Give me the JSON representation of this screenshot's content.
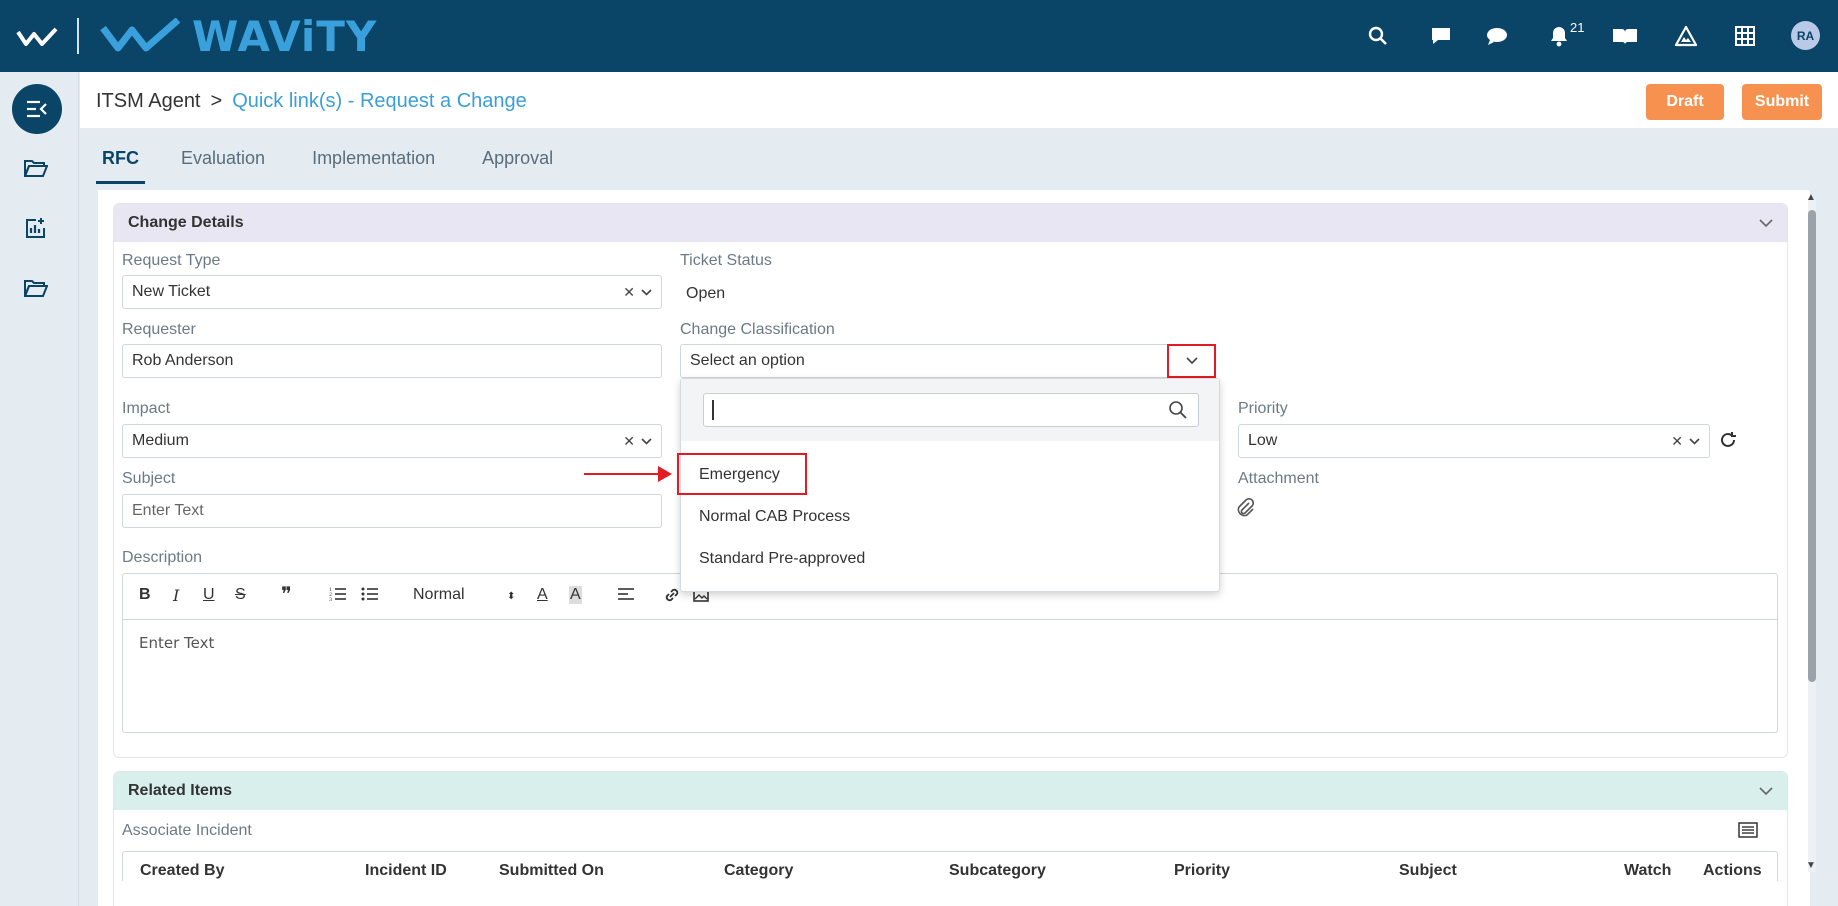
{
  "brand": {
    "name": "WAViTY"
  },
  "topbar": {
    "notification_count": "21",
    "avatar_initials": "RA"
  },
  "breadcrumb": {
    "root": "ITSM Agent",
    "separator": ">",
    "current": "Quick link(s) - Request a Change"
  },
  "actions": {
    "draft_label": "Draft",
    "submit_label": "Submit"
  },
  "tabs": [
    {
      "label": "RFC",
      "active": true
    },
    {
      "label": "Evaluation",
      "active": false
    },
    {
      "label": "Implementation",
      "active": false
    },
    {
      "label": "Approval",
      "active": false
    }
  ],
  "change_details": {
    "title": "Change Details",
    "request_type": {
      "label": "Request Type",
      "value": "New Ticket"
    },
    "ticket_status": {
      "label": "Ticket Status",
      "value": "Open"
    },
    "requester": {
      "label": "Requester",
      "value": "Rob Anderson"
    },
    "change_classification": {
      "label": "Change Classification",
      "placeholder": "Select an option"
    },
    "impact": {
      "label": "Impact",
      "value": "Medium"
    },
    "priority": {
      "label": "Priority",
      "value": "Low"
    },
    "subject": {
      "label": "Subject",
      "placeholder": "Enter Text"
    },
    "attachment": {
      "label": "Attachment"
    },
    "description": {
      "label": "Description",
      "placeholder": "Enter Text",
      "format_value": "Normal"
    }
  },
  "dropdown": {
    "search_value": "",
    "options": [
      "Emergency",
      "Normal CAB Process",
      "Standard Pre-approved"
    ]
  },
  "related_items": {
    "title": "Related Items",
    "associate_incident_label": "Associate Incident",
    "columns": [
      "Created By",
      "Incident ID",
      "Submitted On",
      "Category",
      "Subcategory",
      "Priority",
      "Subject",
      "Watch List",
      "Actions"
    ]
  },
  "colors": {
    "topbar": "#0a4466",
    "brand_blue": "#3aa0dc",
    "link_blue": "#3b9fd6",
    "accent_orange": "#f6914f",
    "highlight_red": "#e31b23"
  }
}
